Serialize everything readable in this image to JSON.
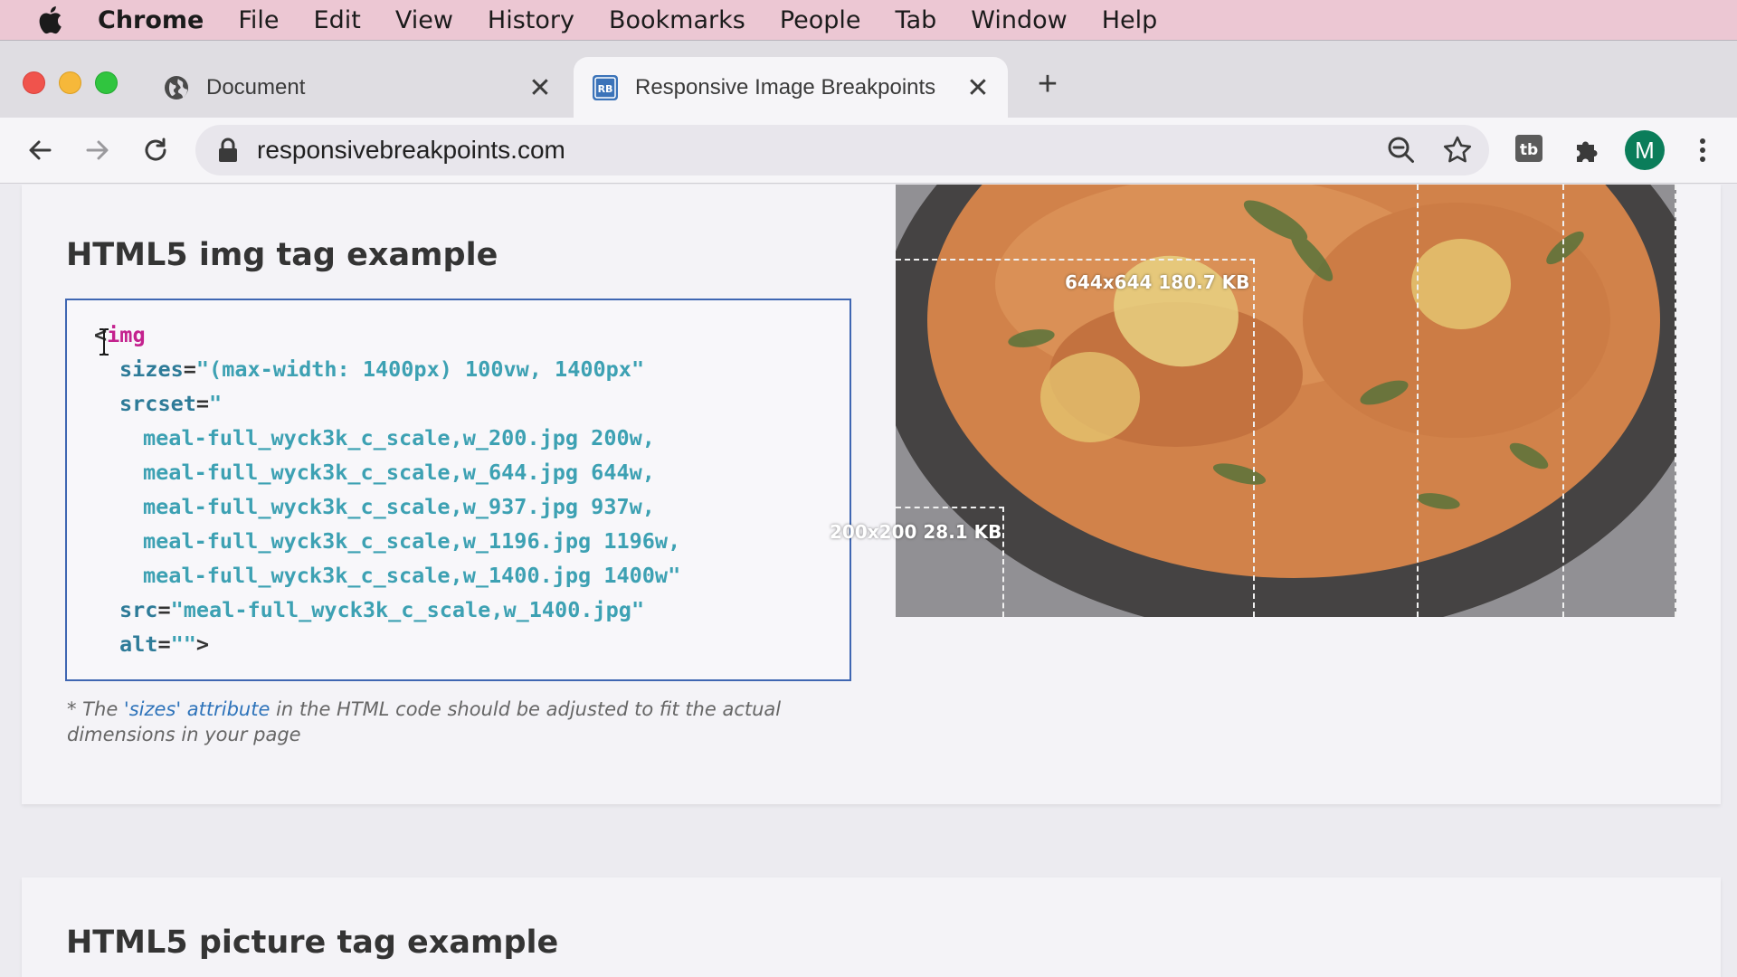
{
  "menubar": {
    "items": [
      "Chrome",
      "File",
      "Edit",
      "View",
      "History",
      "Bookmarks",
      "People",
      "Tab",
      "Window",
      "Help"
    ]
  },
  "tabs": [
    {
      "title": "Document",
      "favicon": "globe-icon"
    },
    {
      "title": "Responsive Image Breakpoints",
      "favicon": "rb-logo-icon",
      "active": true
    }
  ],
  "toolbar": {
    "url": "responsivebreakpoints.com",
    "avatar_letter": "M"
  },
  "section1": {
    "title": "HTML5 img tag example",
    "code": {
      "open": "<",
      "tag": "img",
      "sizes_attr": "sizes",
      "sizes_val": "\"(max-width: 1400px) 100vw, 1400px\"",
      "srcset_attr": "srcset",
      "srcset_open": "\"",
      "srcset_lines": [
        "meal-full_wyck3k_c_scale,w_200.jpg 200w,",
        "meal-full_wyck3k_c_scale,w_644.jpg 644w,",
        "meal-full_wyck3k_c_scale,w_937.jpg 937w,",
        "meal-full_wyck3k_c_scale,w_1196.jpg 1196w,",
        "meal-full_wyck3k_c_scale,w_1400.jpg 1400w\""
      ],
      "src_attr": "src",
      "src_val": "\"meal-full_wyck3k_c_scale,w_1400.jpg\"",
      "alt_attr": "alt",
      "alt_val": "\"\"",
      "close": ">"
    },
    "note_prefix": "* The ",
    "note_link": "'sizes' attribute",
    "note_suffix": " in the HTML code should be adjusted to fit the actual dimensions in your page",
    "breakpoints": [
      {
        "label": "644x644 180.7 KB"
      },
      {
        "label": "200x200 28.1 KB"
      }
    ]
  },
  "section2": {
    "title": "HTML5 picture tag example"
  },
  "colors": {
    "menubar": "#ecc7d3",
    "code_border": "#3f66b2",
    "attr": "#2e7b98",
    "value": "#3da1b3",
    "tag": "#c4228e",
    "avatar": "#0b7d5a"
  }
}
